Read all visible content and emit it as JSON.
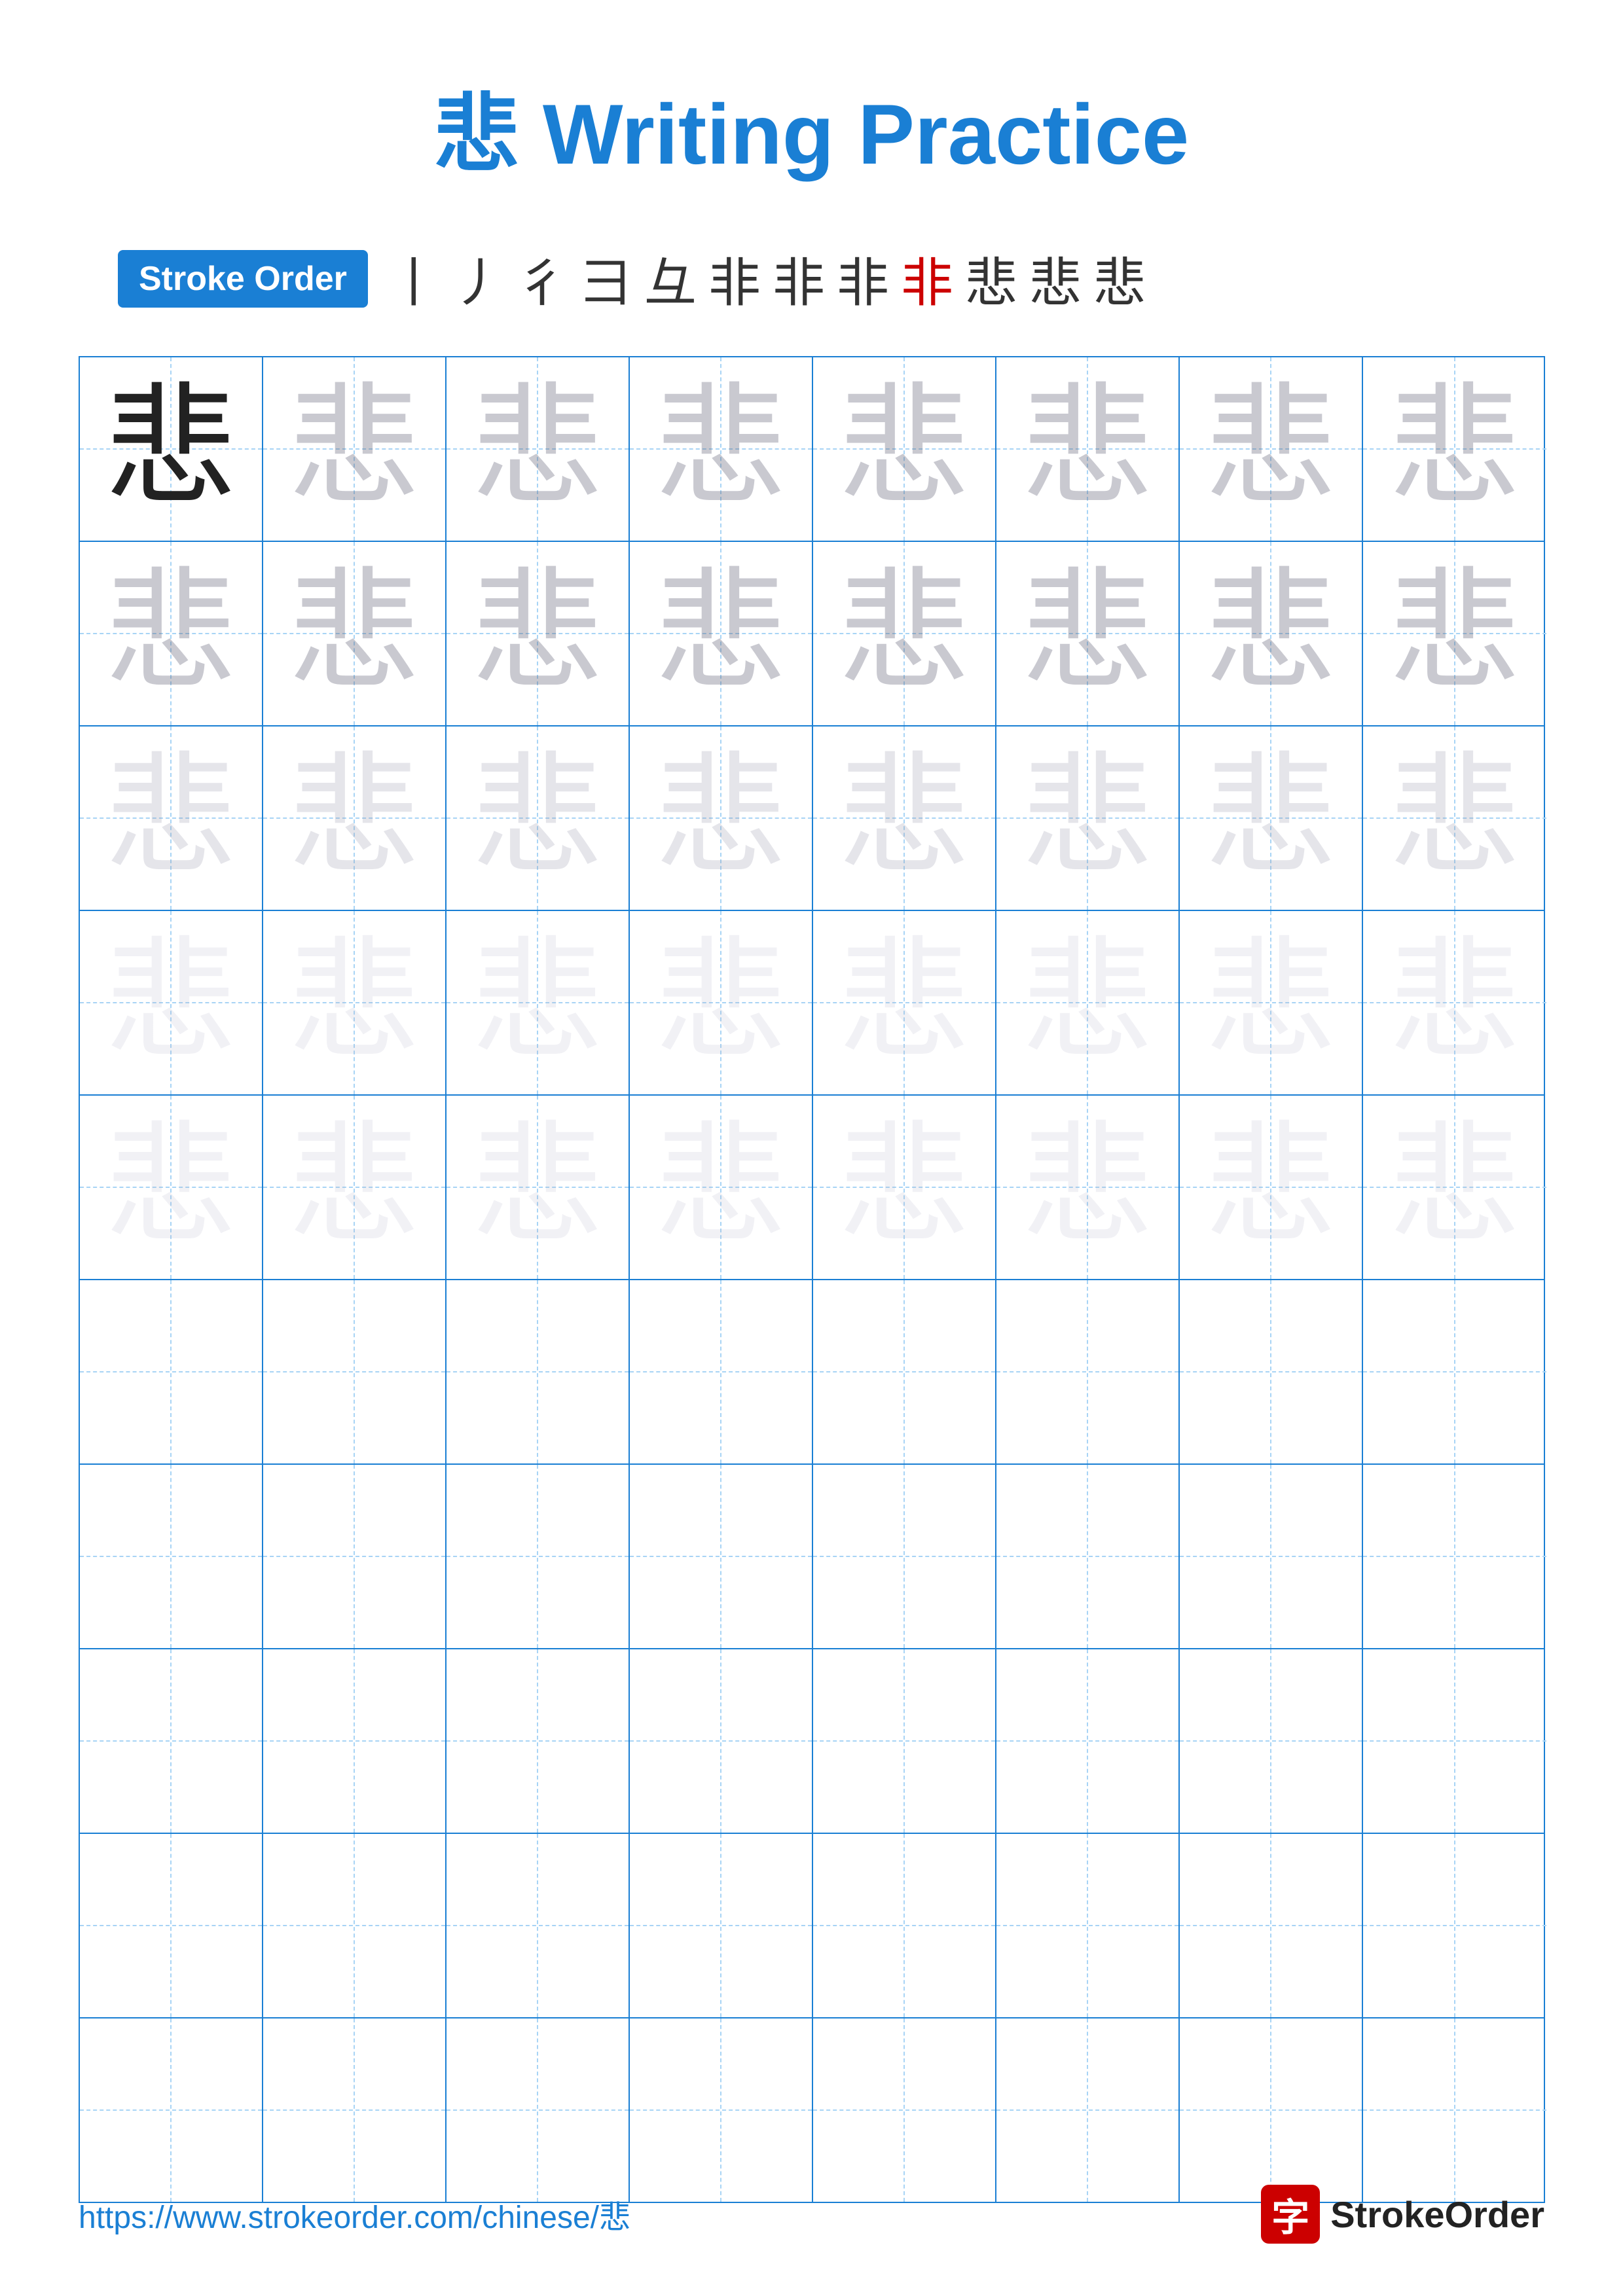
{
  "title": {
    "prefix_char": "悲",
    "text": " Writing Practice"
  },
  "stroke_order": {
    "label": "Stroke Order",
    "steps": [
      "丨",
      "丿",
      "彳",
      "彐",
      "彑",
      "非",
      "非",
      "非",
      "非",
      "悲",
      "悲",
      "悲"
    ]
  },
  "grid": {
    "rows": 10,
    "cols": 8,
    "char": "悲",
    "practice_rows": [
      {
        "type": "dark_then_light1"
      },
      {
        "type": "light1"
      },
      {
        "type": "light2"
      },
      {
        "type": "light3"
      },
      {
        "type": "light3"
      },
      {
        "type": "empty"
      },
      {
        "type": "empty"
      },
      {
        "type": "empty"
      },
      {
        "type": "empty"
      },
      {
        "type": "empty"
      }
    ]
  },
  "footer": {
    "url": "https://www.strokeorder.com/chinese/悲",
    "logo_char": "字",
    "logo_text": "StrokeOrder"
  }
}
